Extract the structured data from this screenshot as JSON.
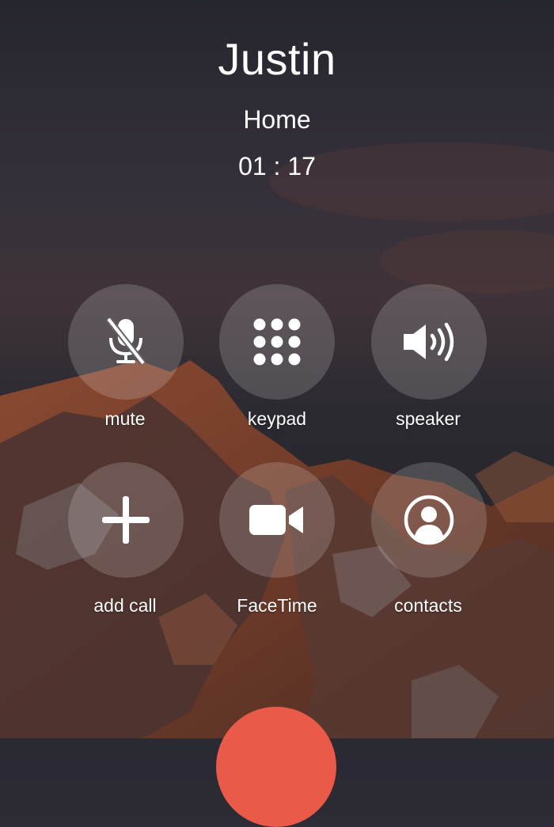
{
  "call": {
    "caller_name": "Justin",
    "line_label": "Home",
    "duration": "01 : 17"
  },
  "buttons": {
    "mute": {
      "label": "mute",
      "icon": "mic-slash-icon"
    },
    "keypad": {
      "label": "keypad",
      "icon": "keypad-grid-icon"
    },
    "speaker": {
      "label": "speaker",
      "icon": "speaker-icon"
    },
    "add_call": {
      "label": "add call",
      "icon": "plus-icon"
    },
    "facetime": {
      "label": "FaceTime",
      "icon": "video-camera-icon"
    },
    "contacts": {
      "label": "contacts",
      "icon": "person-circle-icon"
    }
  },
  "end_call": {
    "icon": "hang-up-icon",
    "color": "#ea5a48"
  },
  "colors": {
    "button_fill": "rgba(255,255,255,0.17)",
    "text": "#ffffff"
  }
}
